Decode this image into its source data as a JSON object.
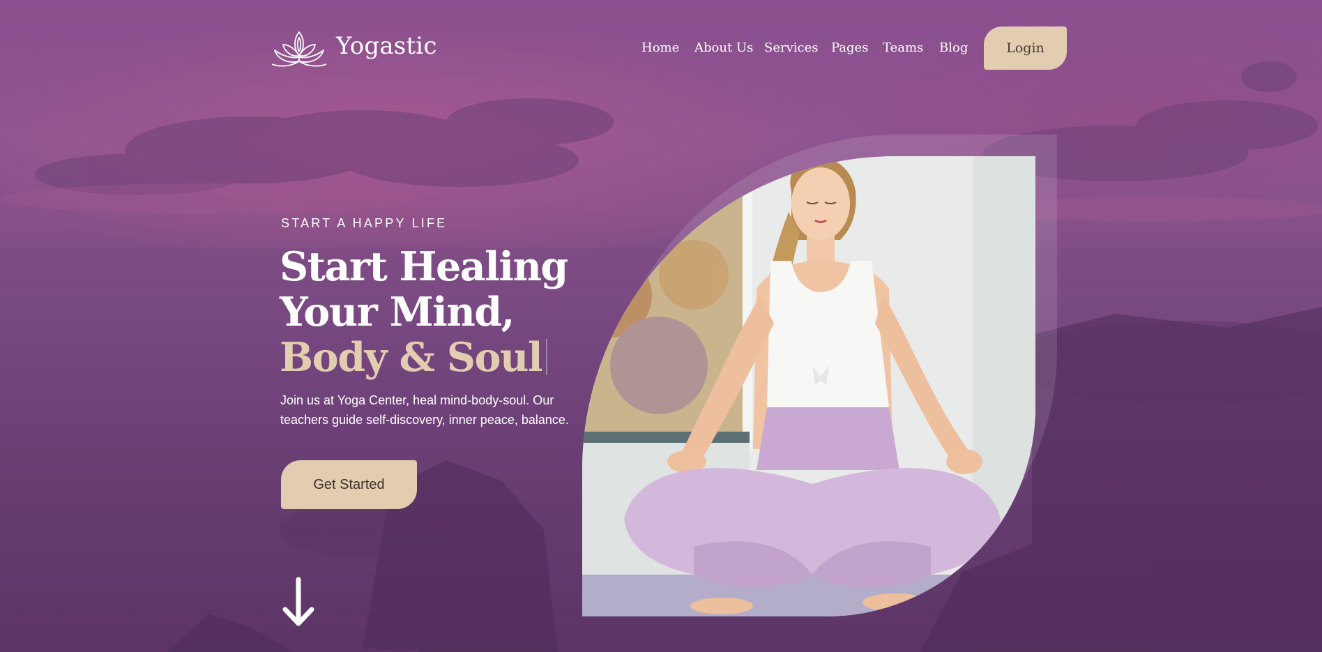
{
  "brand": {
    "name": "Yogastic",
    "logo_icon": "lotus-icon"
  },
  "nav": {
    "items": [
      {
        "label": "Home"
      },
      {
        "label": "About Us"
      },
      {
        "label": "Services"
      },
      {
        "label": "Pages"
      },
      {
        "label": "Teams"
      },
      {
        "label": "Blog"
      }
    ],
    "login_label": "Login"
  },
  "hero": {
    "eyebrow": "START A HAPPY LIFE",
    "headline_line1": "Start Healing",
    "headline_line2": "Your Mind,",
    "headline_accent": "Body & Soul",
    "description": "Join us at Yoga Center, heal mind-body-soul. Our teachers guide self-discovery, inner peace, balance.",
    "cta_label": "Get Started",
    "scroll_icon": "arrow-down-icon",
    "image": "woman-meditating-photo"
  },
  "colors": {
    "overlay_purple": "#7b4a84",
    "accent_beige": "#e3cdb0",
    "button_text": "#3f2f2c"
  }
}
